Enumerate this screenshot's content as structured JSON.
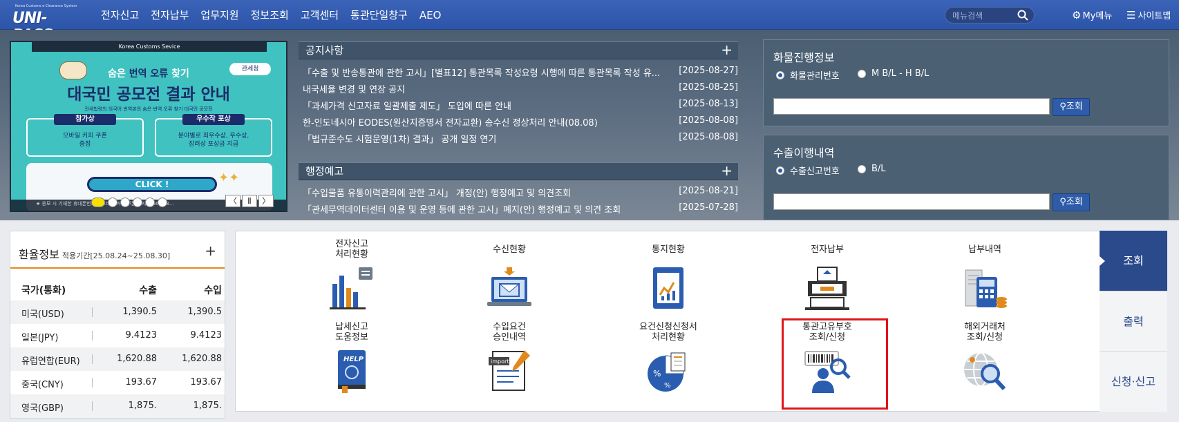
{
  "header": {
    "logo_small": "Korea Customs e-Clearance System",
    "logo_text": "UNI-PASS",
    "nav": [
      "전자신고",
      "전자납부",
      "업무지원",
      "정보조회",
      "고객센터",
      "통관단일창구",
      "AEO"
    ],
    "search_placeholder": "메뉴검색",
    "my_menu": "My메뉴",
    "sitemap": "사이트맵"
  },
  "banner": {
    "header": "Korea Customs Sevice",
    "line1_a": "숨은 ",
    "line1_b": "번역 오류",
    "line1_c": " 찾기",
    "line2": "대국민 공모전 결과 안내",
    "org": "관세청",
    "line3": "관세법령의 외국어 번역본의 숨은 번역 오류 찾기 대국민 공모전",
    "box1_label": "참가상",
    "box1_text": "모바일 커피 쿠폰\n증정",
    "box2_label": "우수작 포상",
    "box2_text": "분야별로 최우수상, 우수상,\n장려상 포상금 지급",
    "click": "CLICK !",
    "footer": "★ 응모 시 기재한 휴대폰번호로 모바일 커피 쿠폰을 지급(66명, 3...",
    "slides": 6,
    "active_slide": 1,
    "prev": "〈",
    "pause": "Ⅱ",
    "next": "〉"
  },
  "notices": {
    "title": "공지사항",
    "plus": "+",
    "items": [
      {
        "title": "「수출 및 반송통관에 관한 고시」[별표12] 통관목록 작성요령 시행에 따른 통관목록 작성 유...",
        "date": "[2025-08-27]"
      },
      {
        "title": "내국세율 변경 및 연장 공지",
        "date": "[2025-08-25]"
      },
      {
        "title": "「과세가격 신고자료 일괄제출 제도」 도입에 따른 안내",
        "date": "[2025-08-13]"
      },
      {
        "title": "한-인도네시아 EODES(원산지증명서 전자교환) 송수신 정상처리 안내(08.08)",
        "date": "[2025-08-08]"
      },
      {
        "title": "「법규준수도 시험운영(1차) 결과」 공개 일정 연기",
        "date": "[2025-08-08]"
      }
    ]
  },
  "admin": {
    "title": "행정예고",
    "plus": "+",
    "items": [
      {
        "title": "「수입물품 유통이력관리에 관한 고시」 개정(안) 행정예고 및 의견조회",
        "date": "[2025-08-21]"
      },
      {
        "title": "「관세무역데이터센터 이용 및 운영 등에 관한 고시」폐지(안) 행정예고 및 의견 조회",
        "date": "[2025-07-28]"
      }
    ]
  },
  "cargo": {
    "title": "화물진행정보",
    "opt1": "화물관리번호",
    "opt2": "M B/L - H B/L",
    "button": "조회"
  },
  "export": {
    "title": "수출이행내역",
    "opt1": "수출신고번호",
    "opt2": "B/L",
    "button": "조회"
  },
  "rates": {
    "title": "환율정보",
    "period": "적용기간[25.08.24~25.08.30]",
    "plus": "+",
    "head": [
      "국가(통화)",
      "수출",
      "수입"
    ],
    "rows": [
      [
        "미국(USD)",
        "1,390.5",
        "1,390.5"
      ],
      [
        "일본(JPY)",
        "9.4123",
        "9.4123"
      ],
      [
        "유럽연합(EUR)",
        "1,620.88",
        "1,620.88"
      ],
      [
        "중국(CNY)",
        "193.67",
        "193.67"
      ],
      [
        "영국(GBP)",
        "1,875.",
        "1,875."
      ]
    ]
  },
  "services": [
    {
      "label": "전자신고\n처리현황",
      "icon": "bar-chart-icon"
    },
    {
      "label": "수신현황",
      "icon": "laptop-mail-icon"
    },
    {
      "label": "통지현황",
      "icon": "report-document-icon"
    },
    {
      "label": "전자납부",
      "icon": "payment-machine-icon"
    },
    {
      "label": "납부내역",
      "icon": "receipt-calculator-icon"
    },
    {
      "label": "납세신고\n도움정보",
      "icon": "help-book-icon"
    },
    {
      "label": "수입요건\n승인내역",
      "icon": "import-document-icon"
    },
    {
      "label": "요건신청신청서\n처리현황",
      "icon": "percent-pie-icon"
    },
    {
      "label": "통관고유부호\n조회/신청",
      "icon": "barcode-person-icon"
    },
    {
      "label": "해외거래처\n조회/신청",
      "icon": "globe-search-icon"
    }
  ],
  "tabs": [
    "조회",
    "출력",
    "신청·신고"
  ],
  "colors": {
    "header": "#2c54a8",
    "accent": "#e08a1e",
    "highlight": "#e0141b",
    "tab_active": "#2b4a8c"
  }
}
